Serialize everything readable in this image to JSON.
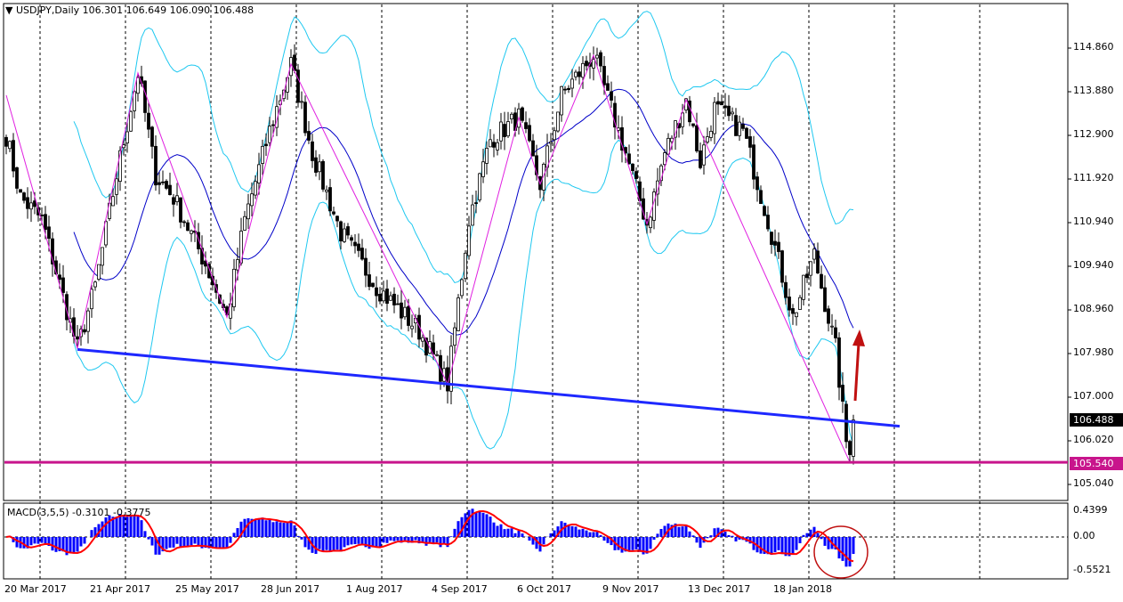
{
  "header": {
    "symbol_timeframe": "USDJPY,Daily",
    "ohlc": "106.301 106.649 106.090 106.488"
  },
  "macd": {
    "title": "MACD(3,5,5) -0.3101 -0.3775",
    "axis": [
      "0.4399",
      "0.00",
      "-0.5521"
    ]
  },
  "price_axis": [
    "114.860",
    "113.880",
    "112.900",
    "111.920",
    "110.940",
    "109.940",
    "108.960",
    "107.980",
    "107.000",
    "106.020",
    "105.040"
  ],
  "current_price": "106.488",
  "support_price": "105.540",
  "dates": [
    "20 Mar 2017",
    "21 Apr 2017",
    "25 May 2017",
    "28 Jun 2017",
    "1 Aug 2017",
    "4 Sep 2017",
    "6 Oct 2017",
    "9 Nov 2017",
    "13 Dec 2017",
    "18 Jan 2018"
  ],
  "colors": {
    "bands": "#1ec8f0",
    "ma": "#0000c8",
    "zigzag": "#e020e0",
    "trend": "#1e28ff",
    "support": "#c8158c",
    "macd_hist": "#0000ff",
    "macd_signal": "#ff0000",
    "arrow": "#c01010"
  },
  "chart_data": {
    "type": "candlestick",
    "ylim": [
      104.9,
      115.4
    ],
    "price_pivots": [
      [
        0,
        112.9
      ],
      [
        4,
        111.5
      ],
      [
        10,
        111.0
      ],
      [
        20,
        108.1
      ],
      [
        25,
        109.5
      ],
      [
        31,
        112.0
      ],
      [
        37,
        114.3
      ],
      [
        42,
        112.0
      ],
      [
        47,
        111.5
      ],
      [
        56,
        110.0
      ],
      [
        62,
        108.8
      ],
      [
        67,
        111.0
      ],
      [
        74,
        113.0
      ],
      [
        80,
        114.5
      ],
      [
        86,
        112.5
      ],
      [
        94,
        110.7
      ],
      [
        104,
        109.5
      ],
      [
        116,
        108.5
      ],
      [
        124,
        107.3
      ],
      [
        130,
        111.0
      ],
      [
        136,
        112.8
      ],
      [
        144,
        113.3
      ],
      [
        150,
        111.8
      ],
      [
        156,
        113.8
      ],
      [
        165,
        114.7
      ],
      [
        174,
        112.5
      ],
      [
        180,
        110.9
      ],
      [
        185,
        112.5
      ],
      [
        191,
        113.7
      ],
      [
        195,
        112.3
      ],
      [
        199,
        113.5
      ],
      [
        207,
        113.0
      ],
      [
        214,
        111.0
      ],
      [
        221,
        108.8
      ],
      [
        227,
        110.2
      ],
      [
        233,
        108.1
      ],
      [
        236,
        106.0
      ],
      [
        237,
        105.9
      ],
      [
        238,
        106.49
      ]
    ],
    "zigzag": [
      [
        0,
        113.8
      ],
      [
        20,
        108.1
      ],
      [
        37,
        114.3
      ],
      [
        62,
        108.8
      ],
      [
        80,
        114.5
      ],
      [
        124,
        107.3
      ],
      [
        144,
        113.3
      ],
      [
        150,
        111.8
      ],
      [
        165,
        114.7
      ],
      [
        180,
        110.9
      ],
      [
        191,
        113.7
      ],
      [
        237,
        105.54
      ]
    ],
    "trendline": [
      [
        20,
        108.08
      ],
      [
        251,
        106.35
      ]
    ],
    "support_level": 105.54,
    "bollinger_period": 20,
    "macd_params": [
      3,
      5,
      5
    ],
    "macd_ylim": [
      -0.5521,
      0.4399
    ]
  }
}
